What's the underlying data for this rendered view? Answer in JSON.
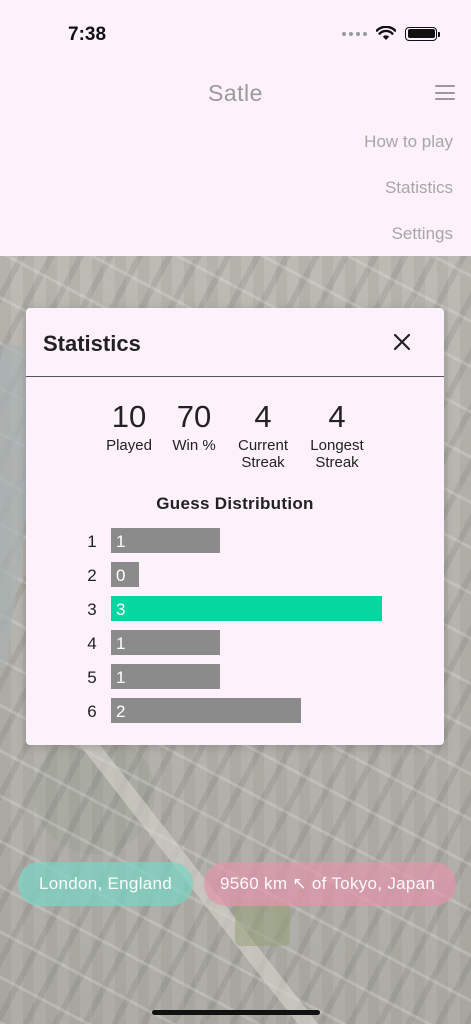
{
  "status_bar": {
    "time": "7:38"
  },
  "header": {
    "title": "Satle"
  },
  "menu": {
    "items": [
      "How to play",
      "Statistics",
      "Settings"
    ]
  },
  "modal": {
    "title": "Statistics",
    "stats": [
      {
        "value": "10",
        "label": "Played"
      },
      {
        "value": "70",
        "label": "Win %"
      },
      {
        "value": "4",
        "label": "Current Streak"
      },
      {
        "value": "4",
        "label": "Longest Streak"
      }
    ],
    "distribution_title": "Guess Distribution",
    "distribution": [
      {
        "guess": "1",
        "count": 1
      },
      {
        "guess": "2",
        "count": 0
      },
      {
        "guess": "3",
        "count": 3,
        "highlight": true
      },
      {
        "guess": "4",
        "count": 1
      },
      {
        "guess": "5",
        "count": 1
      },
      {
        "guess": "6",
        "count": 2
      }
    ],
    "highlight_color": "#06d6a0",
    "bar_color": "#8b8b8b"
  },
  "results": {
    "city": "London, England",
    "distance": "9560 km ↖ of Tokyo, Japan"
  }
}
